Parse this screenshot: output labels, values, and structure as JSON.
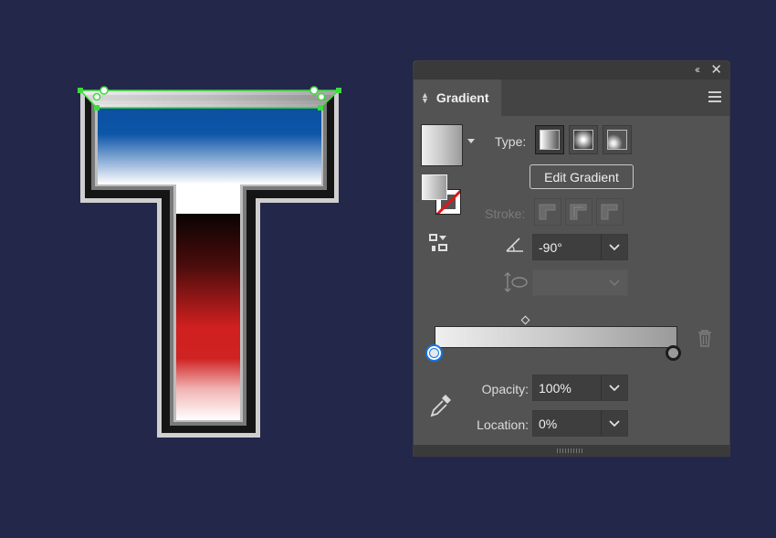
{
  "panel": {
    "tab_label": "Gradient",
    "type_label": "Type:",
    "edit_gradient_label": "Edit Gradient",
    "stroke_label": "Stroke:",
    "angle_value": "-90°",
    "opacity_label": "Opacity:",
    "opacity_value": "100%",
    "location_label": "Location:",
    "location_value": "0%",
    "gradient_type": "linear",
    "gradient_colors": [
      "#efefef",
      "#9a9a9a"
    ]
  },
  "colors": {
    "canvas_background": "#23274a",
    "panel_background": "#535353",
    "selection": "#3ddb3d",
    "active_stop_border": "#1473e6"
  }
}
